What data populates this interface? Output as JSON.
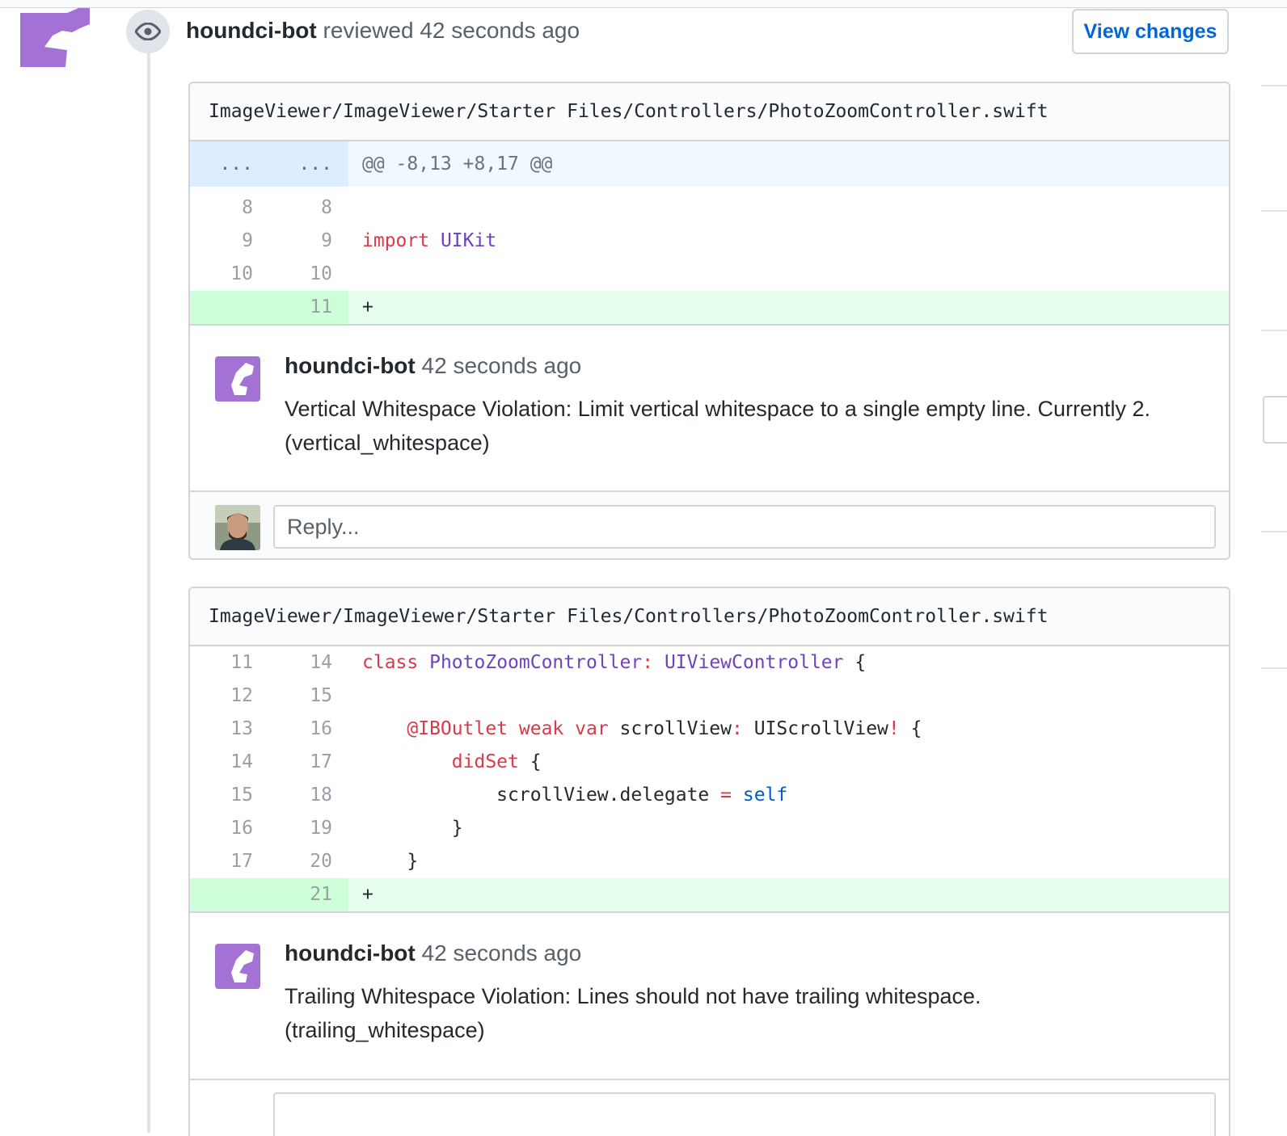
{
  "review": {
    "author": "houndci-bot",
    "action": "reviewed",
    "time": "42 seconds ago",
    "view_changes_label": "View changes"
  },
  "threads": [
    {
      "file_path": "ImageViewer/ImageViewer/Starter Files/Controllers/PhotoZoomController.swift",
      "hunk": {
        "old": "...",
        "new": "...",
        "header": "@@ -8,13 +8,17 @@"
      },
      "lines": [
        {
          "old": "8",
          "new": "8",
          "code": ""
        },
        {
          "old": "9",
          "new": "9",
          "code_kw": "import",
          "code_ty": "UIKit"
        },
        {
          "old": "10",
          "new": "10",
          "code": ""
        },
        {
          "old": "",
          "new": "11",
          "code": "+",
          "added": true
        }
      ],
      "comment": {
        "author": "houndci-bot",
        "time": "42 seconds ago",
        "body": "Vertical Whitespace Violation: Limit vertical whitespace to a single empty line. Currently 2. (vertical_whitespace)"
      },
      "reply_placeholder": "Reply..."
    },
    {
      "file_path": "ImageViewer/ImageViewer/Starter Files/Controllers/PhotoZoomController.swift",
      "lines": [
        {
          "old": "11",
          "new": "14",
          "kw": "class",
          "ty1": "PhotoZoomController",
          "colon": ":",
          "ty2": "UIViewController",
          "brace": " {"
        },
        {
          "old": "12",
          "new": "15",
          "code": ""
        },
        {
          "old": "13",
          "new": "16",
          "kw1": "@IBOutlet",
          "kw2": "weak",
          "kw3": "var",
          "name": "scrollView",
          "colon": ":",
          "type": "UIScrollView",
          "bang": "!",
          "brace": " {"
        },
        {
          "old": "14",
          "new": "17",
          "kw": "didSet",
          "brace": " {"
        },
        {
          "old": "15",
          "new": "18",
          "lhs": "scrollView.delegate",
          "op": "=",
          "rhs": "self"
        },
        {
          "old": "16",
          "new": "19",
          "code": "}"
        },
        {
          "old": "17",
          "new": "20",
          "code": "}"
        },
        {
          "old": "",
          "new": "21",
          "code": "+",
          "added": true
        }
      ],
      "comment": {
        "author": "houndci-bot",
        "time": "42 seconds ago",
        "body": "Trailing Whitespace Violation: Lines should not have trailing whitespace. (trailing_whitespace)"
      }
    }
  ],
  "colors": {
    "bot_avatar": "#a472d4",
    "keyword": "#d73a49",
    "type": "#6f42c1",
    "builtin": "#005cc5",
    "added_bg": "#e6ffed",
    "hunk_bg": "#f1f8ff",
    "link": "#0366d6"
  },
  "icons": [
    "eye-icon",
    "houndci-bot-avatar",
    "user-avatar"
  ]
}
